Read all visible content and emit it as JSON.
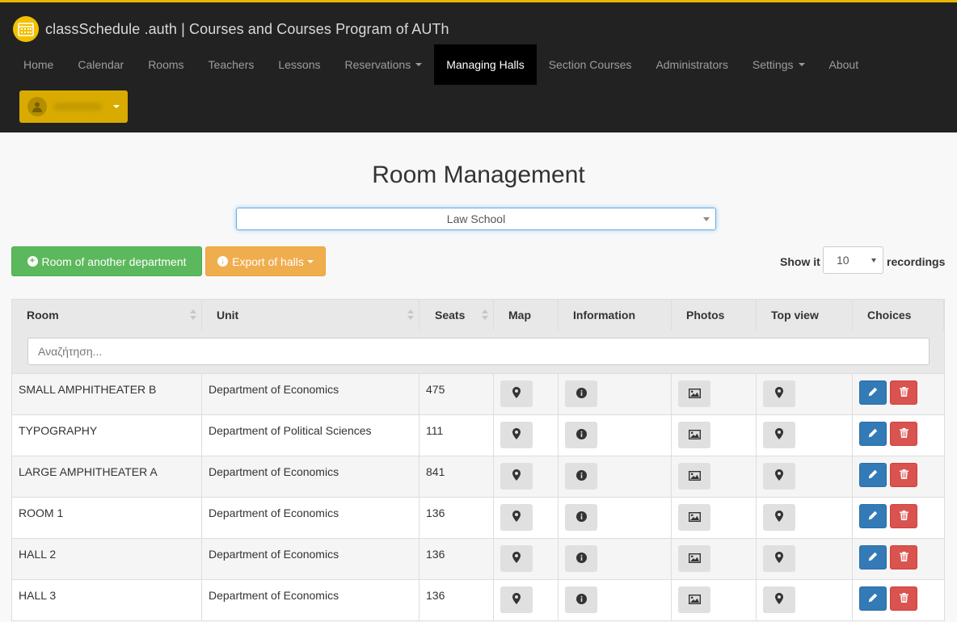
{
  "app": {
    "title": "classSchedule .auth | Courses and Courses Program of AUTh",
    "accent_color": "#e6b800"
  },
  "nav": {
    "items": [
      {
        "label": "Home"
      },
      {
        "label": "Calendar"
      },
      {
        "label": "Rooms"
      },
      {
        "label": "Teachers"
      },
      {
        "label": "Lessons"
      },
      {
        "label": "Reservations",
        "dropdown": true
      },
      {
        "label": "Managing Halls",
        "active": true
      },
      {
        "label": "Section Courses"
      },
      {
        "label": "Administrators"
      },
      {
        "label": "Settings",
        "dropdown": true
      },
      {
        "label": "About"
      }
    ],
    "user": {
      "name": "ptrofessor"
    }
  },
  "main": {
    "title": "Room Management",
    "department_select": {
      "value": "Law School"
    },
    "buttons": {
      "add_other_dept": "Room of another department",
      "export": "Export of halls"
    },
    "length": {
      "show_label": "Show it",
      "value": "10",
      "suffix": "recordings"
    }
  },
  "table": {
    "columns": [
      "Room",
      "Unit",
      "Seats",
      "Map",
      "Information",
      "Photos",
      "Top view",
      "Choices"
    ],
    "search_placeholder": "Αναζήτηση...",
    "rows": [
      {
        "room": "SMALL AMPHITHEATER B",
        "unit": "Department of Economics",
        "seats": "475"
      },
      {
        "room": "TYPOGRAPHY",
        "unit": "Department of Political Sciences",
        "seats": "111"
      },
      {
        "room": "LARGE AMPHITHEATER A",
        "unit": "Department of Economics",
        "seats": "841"
      },
      {
        "room": "ROOM 1",
        "unit": "Department of Economics",
        "seats": "136"
      },
      {
        "room": "HALL 2",
        "unit": "Department of Economics",
        "seats": "136"
      },
      {
        "room": "HALL 3",
        "unit": "Department of Economics",
        "seats": "136"
      }
    ]
  },
  "icons": {
    "map": "map-marker-icon",
    "info": "info-icon",
    "photo": "picture-icon",
    "top_view": "map-marker-icon",
    "edit": "pencil-icon",
    "delete": "trash-icon"
  },
  "colors": {
    "success": "#5cb85c",
    "warning": "#f0ad4e",
    "primary": "#337ab7",
    "danger": "#d9534f"
  }
}
